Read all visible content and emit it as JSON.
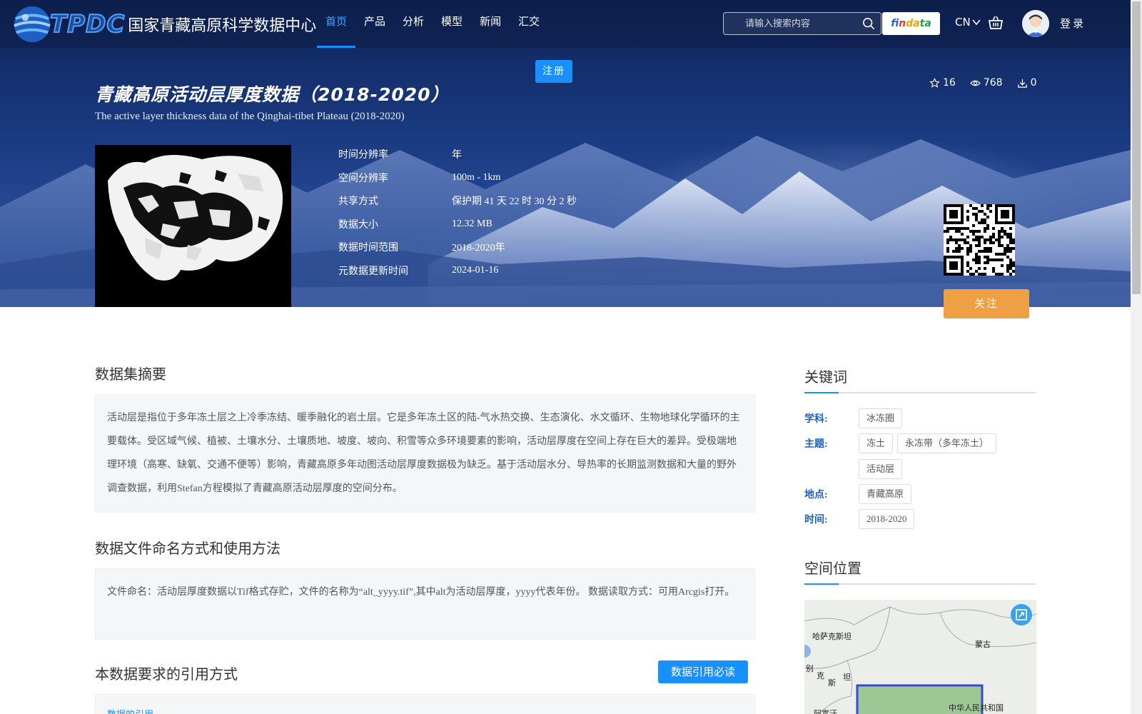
{
  "header": {
    "logo_en": "TPDC",
    "logo_cn": "国家青藏高原科学数据中心",
    "nav": [
      {
        "label": "首页",
        "active": true
      },
      {
        "label": "产品",
        "active": false
      },
      {
        "label": "分析",
        "active": false
      },
      {
        "label": "模型",
        "active": false
      },
      {
        "label": "新闻",
        "active": false
      },
      {
        "label": "汇交",
        "active": false
      }
    ],
    "search_placeholder": "请输入搜索内容",
    "findata": {
      "p1": "fi",
      "p2": "n",
      "p3": "da",
      "p4": "ta"
    },
    "lang": "CN",
    "login": "登录",
    "register": "注册"
  },
  "dataset": {
    "title": "青藏高原活动层厚度数据（2018-2020）",
    "subtitle": "The active layer thickness data of the Qinghai-tibet Plateau (2018-2020)",
    "stats": {
      "stars": "16",
      "views": "768",
      "downloads": "0"
    },
    "meta": [
      {
        "label": "时间分辨率",
        "value": "年"
      },
      {
        "label": "空间分辨率",
        "value": "100m - 1km"
      },
      {
        "label": "共享方式",
        "value": "保护期 41 天 22 时 30 分 2 秒"
      },
      {
        "label": "数据大小",
        "value": "12.32 MB"
      },
      {
        "label": "数据时间范围",
        "value": "2018-2020年"
      },
      {
        "label": "元数据更新时间",
        "value": "2024-01-16"
      }
    ],
    "follow": "关注"
  },
  "main": {
    "summary_title": "数据集摘要",
    "summary_text": "活动层是指位于多年冻土层之上冷季冻结、暖季融化的岩土层。它是多年冻土区的陆-气水热交换、生态演化、水文循环、生物地球化学循环的主要载体。受区域气候、植被、土壤水分、土壤质地、坡度、坡向、积雪等众多环境要素的影响，活动层厚度在空间上存在巨大的差异。受极端地理环境（高寒、缺氧、交通不便等）影响，青藏高原多年动图活动层厚度数据极为缺乏。基于活动层水分、导热率的长期监测数据和大量的野外调查数据，利用Stefan方程模拟了青藏高原活动层厚度的空间分布。",
    "naming_title": "数据文件命名方式和使用方法",
    "naming_text": "文件命名：活动层厚度数据以Tif格式存贮，文件的名称为“alt_yyyy.tif”,其中alt为活动层厚度，yyyy代表年份。 数据读取方式：可用Arcgis打开。",
    "cite_title": "本数据要求的引用方式",
    "cite_button": "数据引用必读",
    "cite_link": "数据的引用"
  },
  "sidebar": {
    "keywords_title": "关键词",
    "keywords": [
      {
        "label": "学科:",
        "tags": [
          "冰冻圈"
        ]
      },
      {
        "label": "主题:",
        "tags": [
          "冻土",
          "永冻带（多年冻土）",
          "活动层"
        ]
      },
      {
        "label": "地点:",
        "tags": [
          "青藏高原"
        ]
      },
      {
        "label": "时间:",
        "tags": [
          "2018-2020"
        ]
      }
    ],
    "location_title": "空间位置",
    "map_labels": {
      "kazakhstan": "哈萨克斯坦",
      "mongolia": "蒙古",
      "bie": "别",
      "ke": "克",
      "si": "斯",
      "tan": "坦",
      "afghan": "阿富汗",
      "china": "中华人民共和国"
    }
  },
  "colors": {
    "accent": "#1890ff",
    "follow": "#f0a044",
    "keyword_label": "#1e5fc2"
  }
}
